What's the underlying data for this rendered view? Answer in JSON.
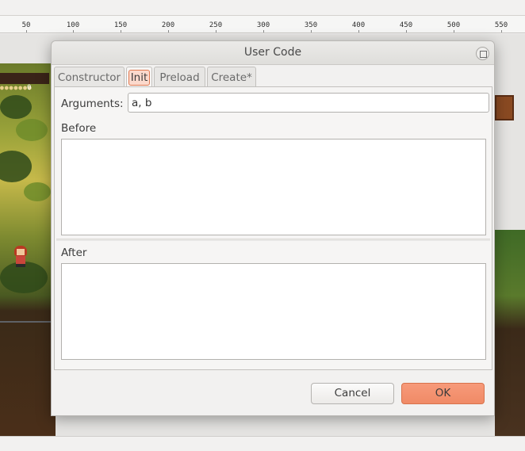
{
  "ruler": {
    "labels": [
      "50",
      "100",
      "150",
      "200",
      "250",
      "300",
      "350",
      "400",
      "450",
      "500",
      "550"
    ]
  },
  "scene": {
    "hud_coins": "●●●●●●●",
    "hud_count": "0"
  },
  "dialog": {
    "title": "User Code",
    "tabs": [
      {
        "label": "Constructor",
        "active": false
      },
      {
        "label": "Init",
        "active": true
      },
      {
        "label": "Preload",
        "active": false
      },
      {
        "label": "Create*",
        "active": false
      }
    ],
    "arguments_label": "Arguments:",
    "arguments_value": "a, b",
    "before_label": "Before",
    "before_code": "",
    "after_label": "After",
    "after_code": "",
    "cancel_label": "Cancel",
    "ok_label": "OK"
  },
  "colors": {
    "accent": "#f08a66",
    "accent_border": "#d8734c",
    "active_tab_highlight": "#fbd9cc"
  }
}
